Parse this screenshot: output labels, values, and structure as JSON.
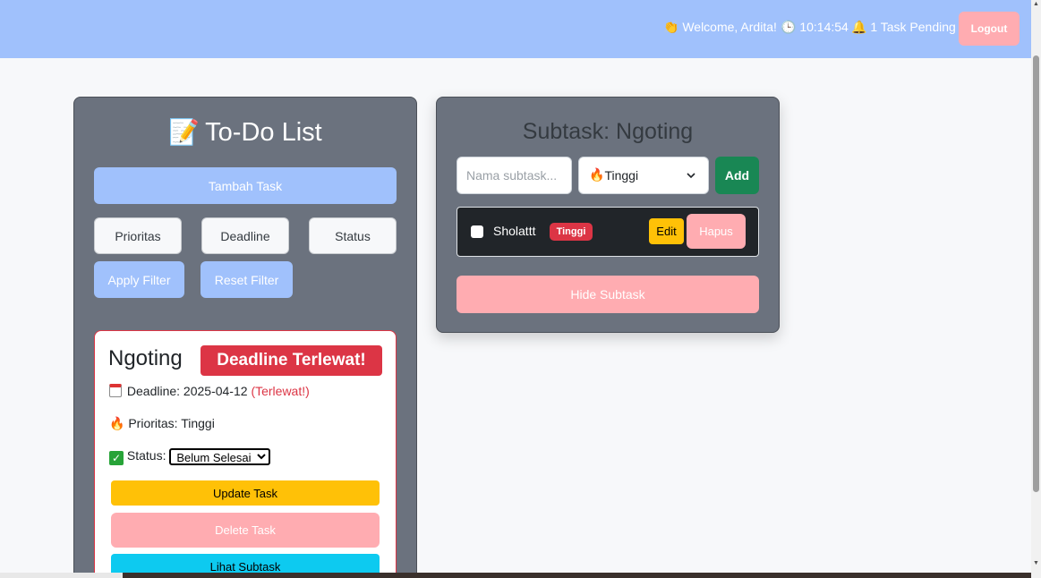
{
  "header": {
    "welcome_icon": "👏",
    "welcome_text": "Welcome, Ardita!",
    "clock_icon": "🕒",
    "time": "10:14:54",
    "bell_icon": "🔔",
    "pending_text": "1 Task Pending",
    "logout_label": "Logout",
    "bg_color": "#a0c1fc"
  },
  "todo": {
    "title_icon": "📝",
    "title": "To-Do List",
    "add_task_label": "Tambah Task",
    "filters": {
      "priority_label": "Prioritas",
      "deadline_label": "Deadline",
      "status_label": "Status",
      "apply_label": "Apply Filter",
      "reset_label": "Reset Filter"
    },
    "task": {
      "name": "Ngoting",
      "badge": "Deadline Terlewat!",
      "deadline_label": "Deadline: 2025-04-12",
      "deadline_status": "(Terlewat!)",
      "priority_icon": "🔥",
      "priority_label": "Prioritas: Tinggi",
      "status_label": "Status:",
      "status_value": "Belum Selesai",
      "update_label": "Update Task",
      "delete_label": "Delete Task",
      "view_subtask_label": "Lihat Subtask"
    }
  },
  "subtask": {
    "title": "Subtask: Ngoting",
    "input_placeholder": "Nama subtask...",
    "priority_icon": "🔥",
    "priority_value": "Tinggi",
    "add_label": "Add",
    "items": [
      {
        "name": "Sholattt",
        "priority": "Tinggi",
        "edit_label": "Edit",
        "delete_label": "Hapus"
      }
    ],
    "hide_label": "Hide Subtask"
  },
  "colors": {
    "panel": "#6b727e",
    "danger": "#dc3545",
    "warning": "#ffc107",
    "info": "#0dcaf0",
    "success": "#198754",
    "soft_red": "#ffacb1",
    "soft_blue": "#a0c1fc"
  }
}
